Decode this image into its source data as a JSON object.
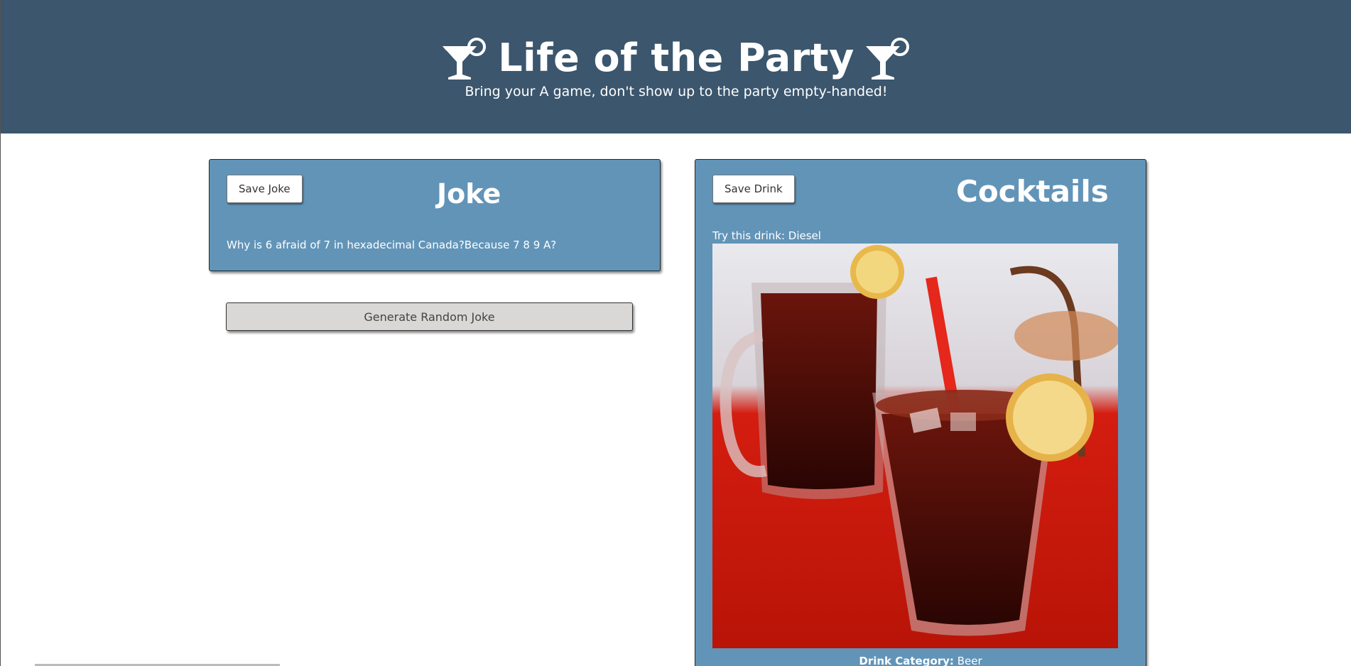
{
  "header": {
    "title": "Life of the Party",
    "subtitle": "Bring your A game, don't show up to the party empty-handed!",
    "icon": "cocktail-icon",
    "background": "#3b566d"
  },
  "joke_card": {
    "save_label": "Save Joke",
    "title": "Joke",
    "text": "Why is 6 afraid of 7 in hexadecimal Canada?Because 7 8 9 A?",
    "background": "#6294b8"
  },
  "generate_button": {
    "label": "Generate Random Joke"
  },
  "drink_card": {
    "save_label": "Save Drink",
    "title": "Cocktails",
    "try_prefix": "Try this drink: ",
    "drink_name": "Diesel",
    "category_label": "Drink Category:",
    "category_value": "Beer",
    "image": "diesel-drink-photo"
  }
}
